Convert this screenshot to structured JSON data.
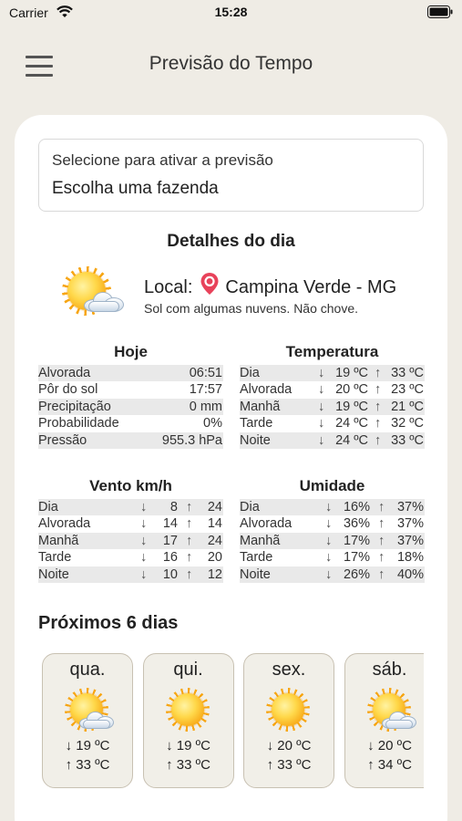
{
  "status_bar": {
    "carrier": "Carrier",
    "time": "15:28"
  },
  "header": {
    "title": "Previsão do Tempo"
  },
  "farm_select": {
    "placeholder": "Selecione para ativar a previsão",
    "value": "Escolha uma fazenda"
  },
  "details": {
    "title": "Detalhes do dia",
    "local_label": "Local:",
    "location": "Campina Verde - MG",
    "description": "Sol com algumas nuvens. Não chove."
  },
  "today": {
    "title": "Hoje",
    "rows": [
      {
        "label": "Alvorada",
        "value": "06:51"
      },
      {
        "label": "Pôr do sol",
        "value": "17:57"
      },
      {
        "label": "Precipitação",
        "value": "0 mm"
      },
      {
        "label": "Probabilidade",
        "value": "0%"
      },
      {
        "label": "Pressão",
        "value": "955.3 hPa"
      }
    ]
  },
  "temperature": {
    "title": "Temperatura",
    "rows": [
      {
        "label": "Dia",
        "min": "19 ºC",
        "max": "33 ºC"
      },
      {
        "label": "Alvorada",
        "min": "20 ºC",
        "max": "23 ºC"
      },
      {
        "label": "Manhã",
        "min": "19 ºC",
        "max": "21 ºC"
      },
      {
        "label": "Tarde",
        "min": "24 ºC",
        "max": "32 ºC"
      },
      {
        "label": "Noite",
        "min": "24 ºC",
        "max": "33 ºC"
      }
    ]
  },
  "wind": {
    "title": "Vento km/h",
    "rows": [
      {
        "label": "Dia",
        "min": "8",
        "max": "24"
      },
      {
        "label": "Alvorada",
        "min": "14",
        "max": "14"
      },
      {
        "label": "Manhã",
        "min": "17",
        "max": "24"
      },
      {
        "label": "Tarde",
        "min": "16",
        "max": "20"
      },
      {
        "label": "Noite",
        "min": "10",
        "max": "12"
      }
    ]
  },
  "humidity": {
    "title": "Umidade",
    "rows": [
      {
        "label": "Dia",
        "min": "16%",
        "max": "37%"
      },
      {
        "label": "Alvorada",
        "min": "36%",
        "max": "37%"
      },
      {
        "label": "Manhã",
        "min": "17%",
        "max": "37%"
      },
      {
        "label": "Tarde",
        "min": "17%",
        "max": "18%"
      },
      {
        "label": "Noite",
        "min": "26%",
        "max": "40%"
      }
    ]
  },
  "next_days": {
    "title": "Próximos 6 dias",
    "days": [
      {
        "name": "qua.",
        "icon": "sun-cloud-icon",
        "min": "19 ºC",
        "max": "33 ºC"
      },
      {
        "name": "qui.",
        "icon": "sun-icon",
        "min": "19 ºC",
        "max": "33 ºC"
      },
      {
        "name": "sex.",
        "icon": "sun-icon",
        "min": "20 ºC",
        "max": "33 ºC"
      },
      {
        "name": "sáb.",
        "icon": "sun-cloud-icon",
        "min": "20 ºC",
        "max": "34 ºC"
      }
    ]
  },
  "glyphs": {
    "down": "↓",
    "up": "↑"
  },
  "colors": {
    "background": "#efece5",
    "card": "#ffffff",
    "pin": "#e8425a",
    "row_alt": "#e9e9e9"
  }
}
